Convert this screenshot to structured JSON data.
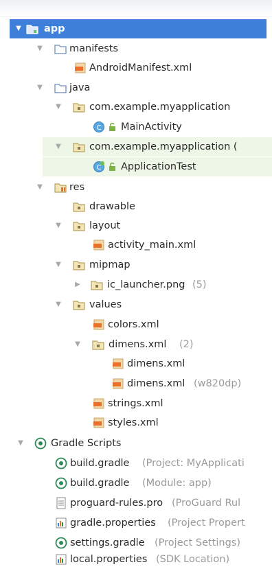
{
  "tree": {
    "app": "app",
    "manifests": "manifests",
    "android_manifest": "AndroidManifest.xml",
    "java": "java",
    "pkg1": "com.example.myapplication",
    "main_activity": "MainActivity",
    "pkg2": "com.example.myapplication (",
    "application_test": "ApplicationTest",
    "res": "res",
    "drawable": "drawable",
    "layout": "layout",
    "activity_main": "activity_main.xml",
    "mipmap": "mipmap",
    "ic_launcher": "ic_launcher.png",
    "ic_launcher_count": "(5)",
    "values": "values",
    "colors": "colors.xml",
    "dimens_group": "dimens.xml",
    "dimens_group_count": "(2)",
    "dimens_1": "dimens.xml",
    "dimens_2": "dimens.xml",
    "dimens_2_qualifier": "(w820dp)",
    "strings": "strings.xml",
    "styles": "styles.xml",
    "gradle_scripts": "Gradle Scripts",
    "build_gradle_project": "build.gradle",
    "build_gradle_project_hint": "(Project: MyApplicati",
    "build_gradle_module": "build.gradle",
    "build_gradle_module_hint": "(Module: app)",
    "proguard": "proguard-rules.pro",
    "proguard_hint": "(ProGuard Rul",
    "gradle_properties": "gradle.properties",
    "gradle_properties_hint": "(Project Propert",
    "settings_gradle": "settings.gradle",
    "settings_gradle_hint": "(Project Settings)",
    "local_properties": "local.properties",
    "local_properties_hint": "(SDK Location)"
  },
  "icons": {
    "folder": "folder-icon",
    "package": "package-icon",
    "xml": "xml-file-icon",
    "class": "class-icon",
    "gradle": "gradle-icon",
    "properties": "properties-file-icon",
    "text": "text-file-icon",
    "expand": "chevron-down-icon",
    "collapse": "chevron-right-icon"
  },
  "colors": {
    "selection": "#3e7fd9",
    "highlight": "#edf6e7",
    "hint": "#9a9a9a",
    "folder": "#6f8fb8",
    "xml": "#e8702a",
    "gradle": "#2e8b57"
  }
}
